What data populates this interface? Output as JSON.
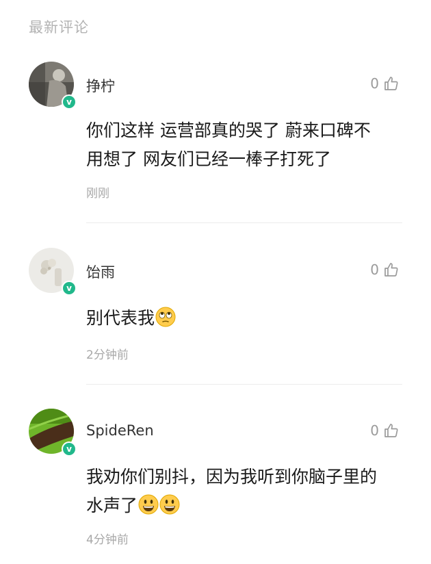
{
  "section_title": "最新评论",
  "comments": [
    {
      "username": "挣柠",
      "likes": "0",
      "text_line1": "你们这样 运营部真的哭了 蔚来口碑不",
      "text_line2": "用想了 网友们已经一棒子打死了",
      "time": "刚刚",
      "verified_badge": "v"
    },
    {
      "username": "饴雨",
      "likes": "0",
      "text": "别代表我",
      "emoji": [
        "face-with-rolling-eyes-emoji"
      ],
      "time": "2分钟前",
      "verified_badge": "v"
    },
    {
      "username": "SpideRen",
      "likes": "0",
      "text_line1": "我劝你们别抖，因为我听到你脑子里的",
      "text_line2": "水声了",
      "emoji": [
        "grinning-face-emoji",
        "grinning-face-emoji"
      ],
      "time": "4分钟前",
      "verified_badge": "v"
    }
  ],
  "colors": {
    "badge": "#21b88b",
    "muted": "#a8a8a8",
    "text": "#1a1a1a"
  }
}
